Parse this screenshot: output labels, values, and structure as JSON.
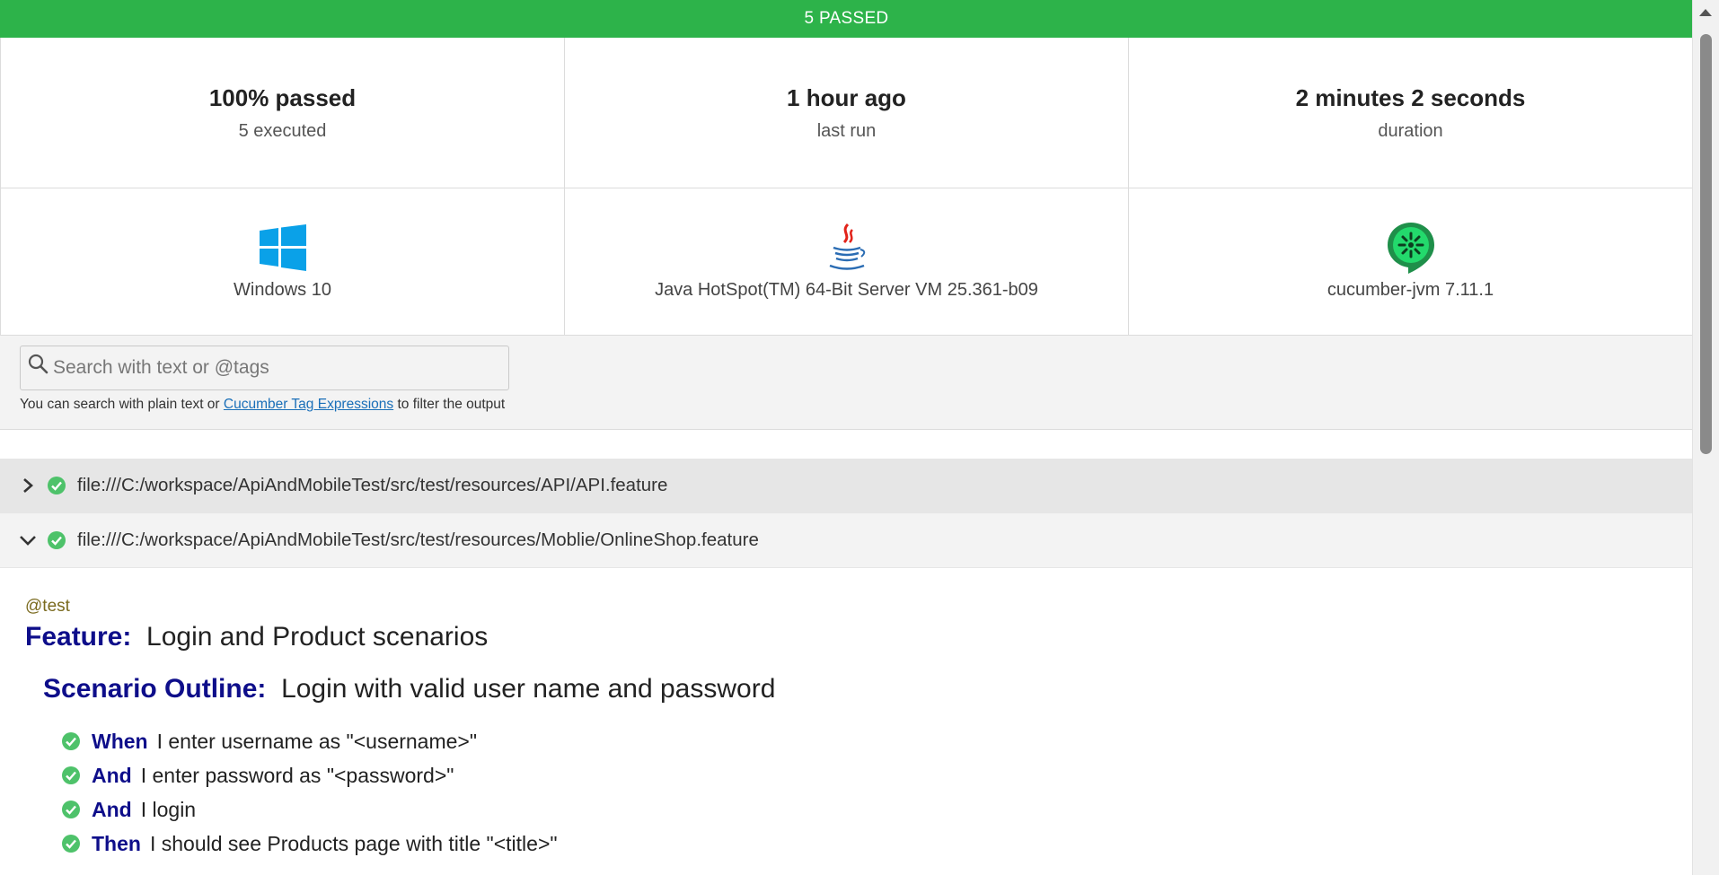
{
  "status": {
    "text": "5 PASSED",
    "color": "#2db34a"
  },
  "stats": [
    {
      "value": "100% passed",
      "label": "5 executed"
    },
    {
      "value": "1 hour ago",
      "label": "last run"
    },
    {
      "value": "2 minutes 2 seconds",
      "label": "duration"
    }
  ],
  "environment": [
    {
      "icon": "windows-icon",
      "label": "Windows 10"
    },
    {
      "icon": "java-icon",
      "label": "Java HotSpot(TM) 64-Bit Server VM 25.361-b09"
    },
    {
      "icon": "cucumber-icon",
      "label": "cucumber-jvm 7.11.1"
    }
  ],
  "search": {
    "placeholder": "Search with text or @tags",
    "hint_prefix": "You can search with plain text or ",
    "hint_link": "Cucumber Tag Expressions",
    "hint_suffix": " to filter the output"
  },
  "features": [
    {
      "path": "file:///C:/workspace/ApiAndMobileTest/src/test/resources/API/API.feature",
      "expanded": false
    },
    {
      "path": "file:///C:/workspace/ApiAndMobileTest/src/test/resources/Moblie/OnlineShop.feature",
      "expanded": true
    }
  ],
  "feature_detail": {
    "tag": "@test",
    "keyword": "Feature:",
    "name": "Login and Product scenarios",
    "scenario_keyword": "Scenario Outline:",
    "scenario_name": "Login with valid user name and password",
    "steps": [
      {
        "keyword": "When",
        "text": "I enter username as \"<username>\""
      },
      {
        "keyword": "And",
        "text": "I enter password as \"<password>\""
      },
      {
        "keyword": "And",
        "text": "I login"
      },
      {
        "keyword": "Then",
        "text": "I should see Products page with title \"<title>\""
      }
    ]
  }
}
